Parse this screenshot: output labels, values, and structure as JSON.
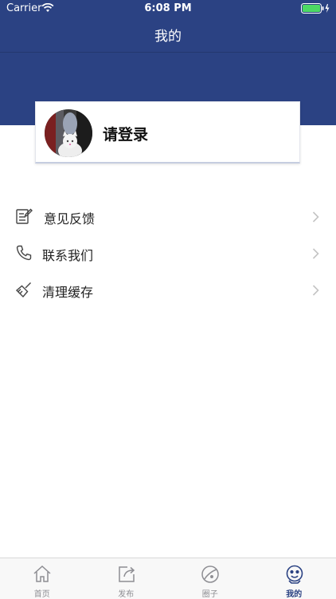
{
  "status_bar": {
    "carrier": "Carrier",
    "time": "6:08 PM"
  },
  "nav": {
    "title": "我的"
  },
  "login_card": {
    "text": "请登录"
  },
  "menu": {
    "items": [
      {
        "label": "意见反馈",
        "icon": "feedback-edit-icon"
      },
      {
        "label": "联系我们",
        "icon": "phone-icon"
      },
      {
        "label": "清理缓存",
        "icon": "broom-icon"
      }
    ]
  },
  "tabbar": {
    "items": [
      {
        "label": "首页",
        "icon": "home-icon",
        "active": false
      },
      {
        "label": "发布",
        "icon": "share-post-icon",
        "active": false
      },
      {
        "label": "圈子",
        "icon": "planet-icon",
        "active": false
      },
      {
        "label": "我的",
        "icon": "profile-face-icon",
        "active": true
      }
    ]
  },
  "colors": {
    "accent": "#2b4283",
    "tab_inactive": "#8e8e93",
    "battery": "#4cd964"
  }
}
